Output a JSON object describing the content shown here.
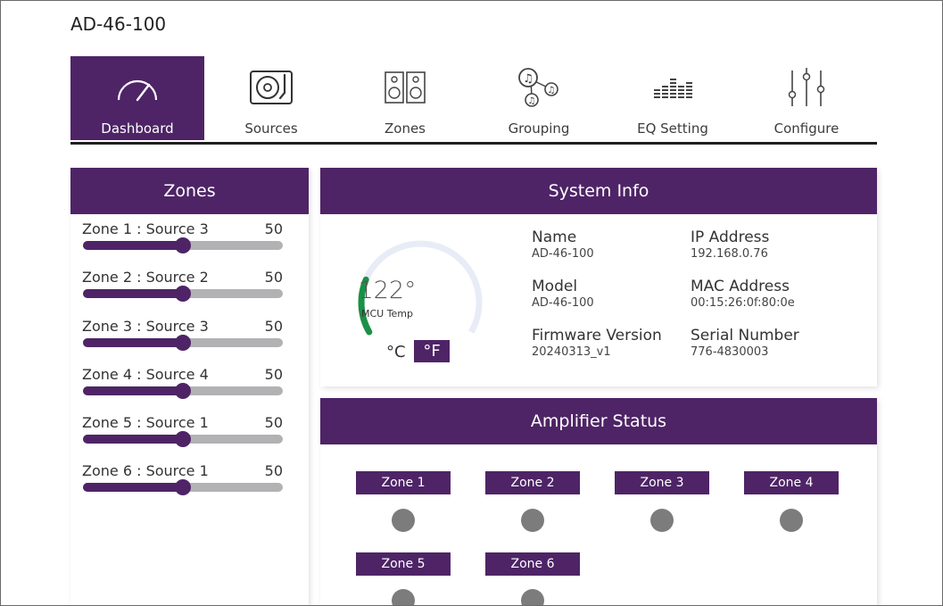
{
  "device_name": "AD-46-100",
  "nav": {
    "tabs": [
      {
        "label": "Dashboard",
        "icon": "speedometer-icon"
      },
      {
        "label": "Sources",
        "icon": "turntable-icon"
      },
      {
        "label": "Zones",
        "icon": "speakers-icon"
      },
      {
        "label": "Grouping",
        "icon": "music-group-icon"
      },
      {
        "label": "EQ Setting",
        "icon": "equalizer-icon"
      },
      {
        "label": "Configure",
        "icon": "sliders-icon"
      }
    ],
    "active_tab": "Dashboard"
  },
  "zones_panel": {
    "title": "Zones",
    "zones": [
      {
        "label": "Zone 1 : Source 3",
        "value": "50",
        "level": 50
      },
      {
        "label": "Zone 2 : Source 2",
        "value": "50",
        "level": 50
      },
      {
        "label": "Zone 3 : Source 3",
        "value": "50",
        "level": 50
      },
      {
        "label": "Zone 4 : Source 4",
        "value": "50",
        "level": 50
      },
      {
        "label": "Zone 5 : Source 1",
        "value": "50",
        "level": 50
      },
      {
        "label": "Zone 6 : Source 1",
        "value": "50",
        "level": 50
      }
    ]
  },
  "system_info": {
    "title": "System Info",
    "temperature": {
      "value": "122°",
      "label": "MCU Temp",
      "unit_c": "°C",
      "unit_f": "°F",
      "selected_unit": "F",
      "gauge_fraction": 0.22
    },
    "name_label": "Name",
    "name_value": "AD-46-100",
    "ip_label": "IP Address",
    "ip_value": "192.168.0.76",
    "model_label": "Model",
    "model_value": "AD-46-100",
    "mac_label": "MAC Address",
    "mac_value": "00:15:26:0f:80:0e",
    "firmware_label": "Firmware Version",
    "firmware_value": "20240313_v1",
    "serial_label": "Serial Number",
    "serial_value": "776-4830003"
  },
  "amplifier_status": {
    "title": "Amplifier Status",
    "zones": [
      "Zone 1",
      "Zone 2",
      "Zone 3",
      "Zone 4",
      "Zone 5",
      "Zone 6"
    ]
  },
  "colors": {
    "accent": "#4e2466",
    "track": "#b2b2b4",
    "gauge_active": "#1a9147",
    "gauge_track": "#e8ecf7",
    "status_dot": "#7c7c7c"
  }
}
